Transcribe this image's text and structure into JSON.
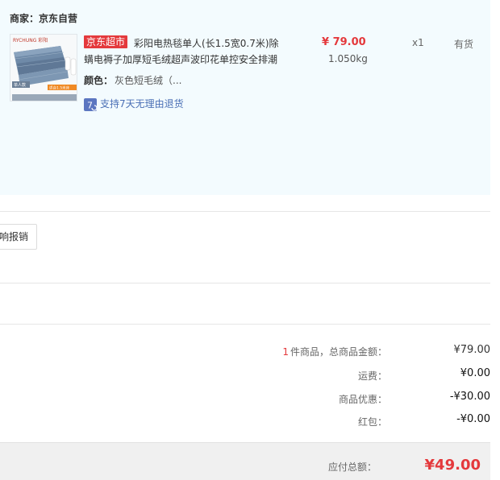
{
  "merchant": {
    "label": "商家：",
    "name": "京东自营"
  },
  "item": {
    "tag": "京东超市",
    "title": "彩阳电热毯单人(长1.5宽0.7米)除螨电褥子加厚短毛绒超声波印花单控安全排潮",
    "color_label": "颜色：",
    "color_value": "灰色短毛绒（...",
    "service_label": "支持7天无理由退货",
    "service_icon": "return-7day-icon",
    "price": "¥ 79.00",
    "weight": "1.050kg",
    "quantity": "x1",
    "stock": "有货",
    "thumb_brand": "RYCHUNG 彩阳",
    "thumb_note": "单人款",
    "thumb_badge": "适合1.5米床"
  },
  "reimburse_button": "响报销",
  "summary": {
    "count": "1",
    "count_label": "件商品，总商品金额：",
    "goods_total": "¥79.00",
    "shipping_label": "运费：",
    "shipping": "¥0.00",
    "discount_label": "商品优惠：",
    "discount": "-¥30.00",
    "redpacket_label": "红包：",
    "redpacket": "-¥0.00"
  },
  "total": {
    "label": "应付总额：",
    "value": "¥49.00"
  },
  "colors": {
    "accent": "#e4393c",
    "panel_bg": "#f3fbfe",
    "link": "#4a6fb5"
  }
}
